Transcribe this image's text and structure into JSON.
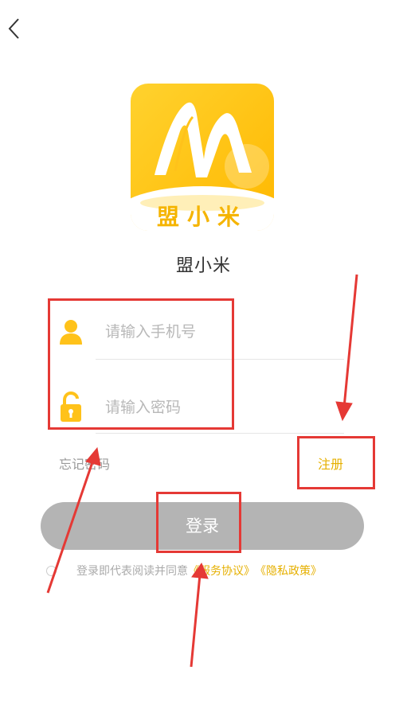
{
  "nav": {
    "back_icon": "chevron-left-icon"
  },
  "logo": {
    "badge_text": "盟小米",
    "brand_color": "#FFC21A"
  },
  "app_name": "盟小米",
  "form": {
    "phone_placeholder": "请输入手机号",
    "phone_icon": "user-icon",
    "password_placeholder": "请输入密码",
    "password_icon": "lock-icon",
    "forgot_password": "忘记密码",
    "register": "注册",
    "login_button": "登录"
  },
  "agreement": {
    "prefix": "登录即代表阅读并同意",
    "service_link": "《服务协议》",
    "privacy_link": "《隐私政策》"
  },
  "colors": {
    "accent": "#E6B000",
    "icon_yellow": "#FFC21A",
    "button_disabled": "#B4B4B4",
    "annotation_red": "#E53935"
  }
}
